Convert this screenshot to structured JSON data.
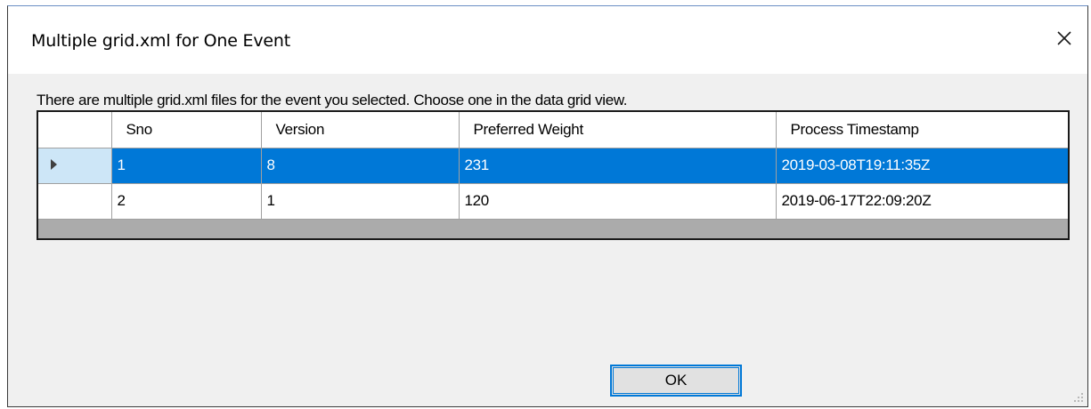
{
  "window": {
    "title": "Multiple grid.xml for One Event"
  },
  "dialog": {
    "message": "There are multiple grid.xml files for the event you selected. Choose one in the data grid view.",
    "ok_label": "OK"
  },
  "grid": {
    "columns": [
      "Sno",
      "Version",
      "Preferred Weight",
      "Process Timestamp"
    ],
    "rows": [
      [
        "1",
        "8",
        "231",
        "2019-03-08T19:11:35Z"
      ],
      [
        "2",
        "1",
        "120",
        "2019-06-17T22:09:20Z"
      ]
    ],
    "selected_row": 1
  },
  "icons": {
    "close": "close-icon",
    "current_row": "current-row-arrow-icon",
    "resize_grip": "resize-grip-icon"
  },
  "colors": {
    "selection": "#0078d7",
    "selection_text": "#ffffff",
    "row_header_selected": "#cde6f7",
    "grid_background": "#ababab",
    "dialog_background": "#f0f0f0",
    "button_focus_border": "#0078d7"
  }
}
